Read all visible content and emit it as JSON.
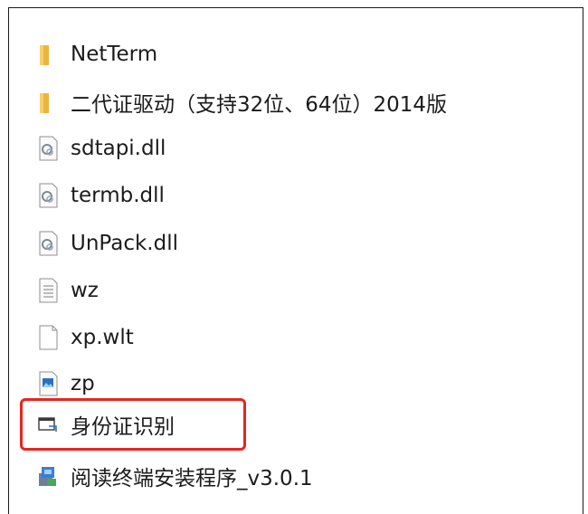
{
  "files": [
    {
      "name": "NetTerm",
      "icon": "folder-icon"
    },
    {
      "name": "二代证驱动（支持32位、64位）2014版",
      "icon": "folder-icon"
    },
    {
      "name": "sdtapi.dll",
      "icon": "dll-file-icon"
    },
    {
      "name": "termb.dll",
      "icon": "dll-file-icon"
    },
    {
      "name": "UnPack.dll",
      "icon": "dll-file-icon"
    },
    {
      "name": "wz",
      "icon": "text-file-icon"
    },
    {
      "name": "xp.wlt",
      "icon": "blank-file-icon"
    },
    {
      "name": "zp",
      "icon": "image-file-icon"
    },
    {
      "name": "身份证识别",
      "icon": "application-shortcut-icon"
    },
    {
      "name": "阅读终端安装程序_v3.0.1",
      "icon": "installer-icon"
    }
  ],
  "highlight": {
    "color": "#e8251f",
    "target": "身份证识别"
  },
  "colors": {
    "text": "#1b1b1b",
    "folder": "#e9b53e",
    "border": "#1a1a1a"
  }
}
